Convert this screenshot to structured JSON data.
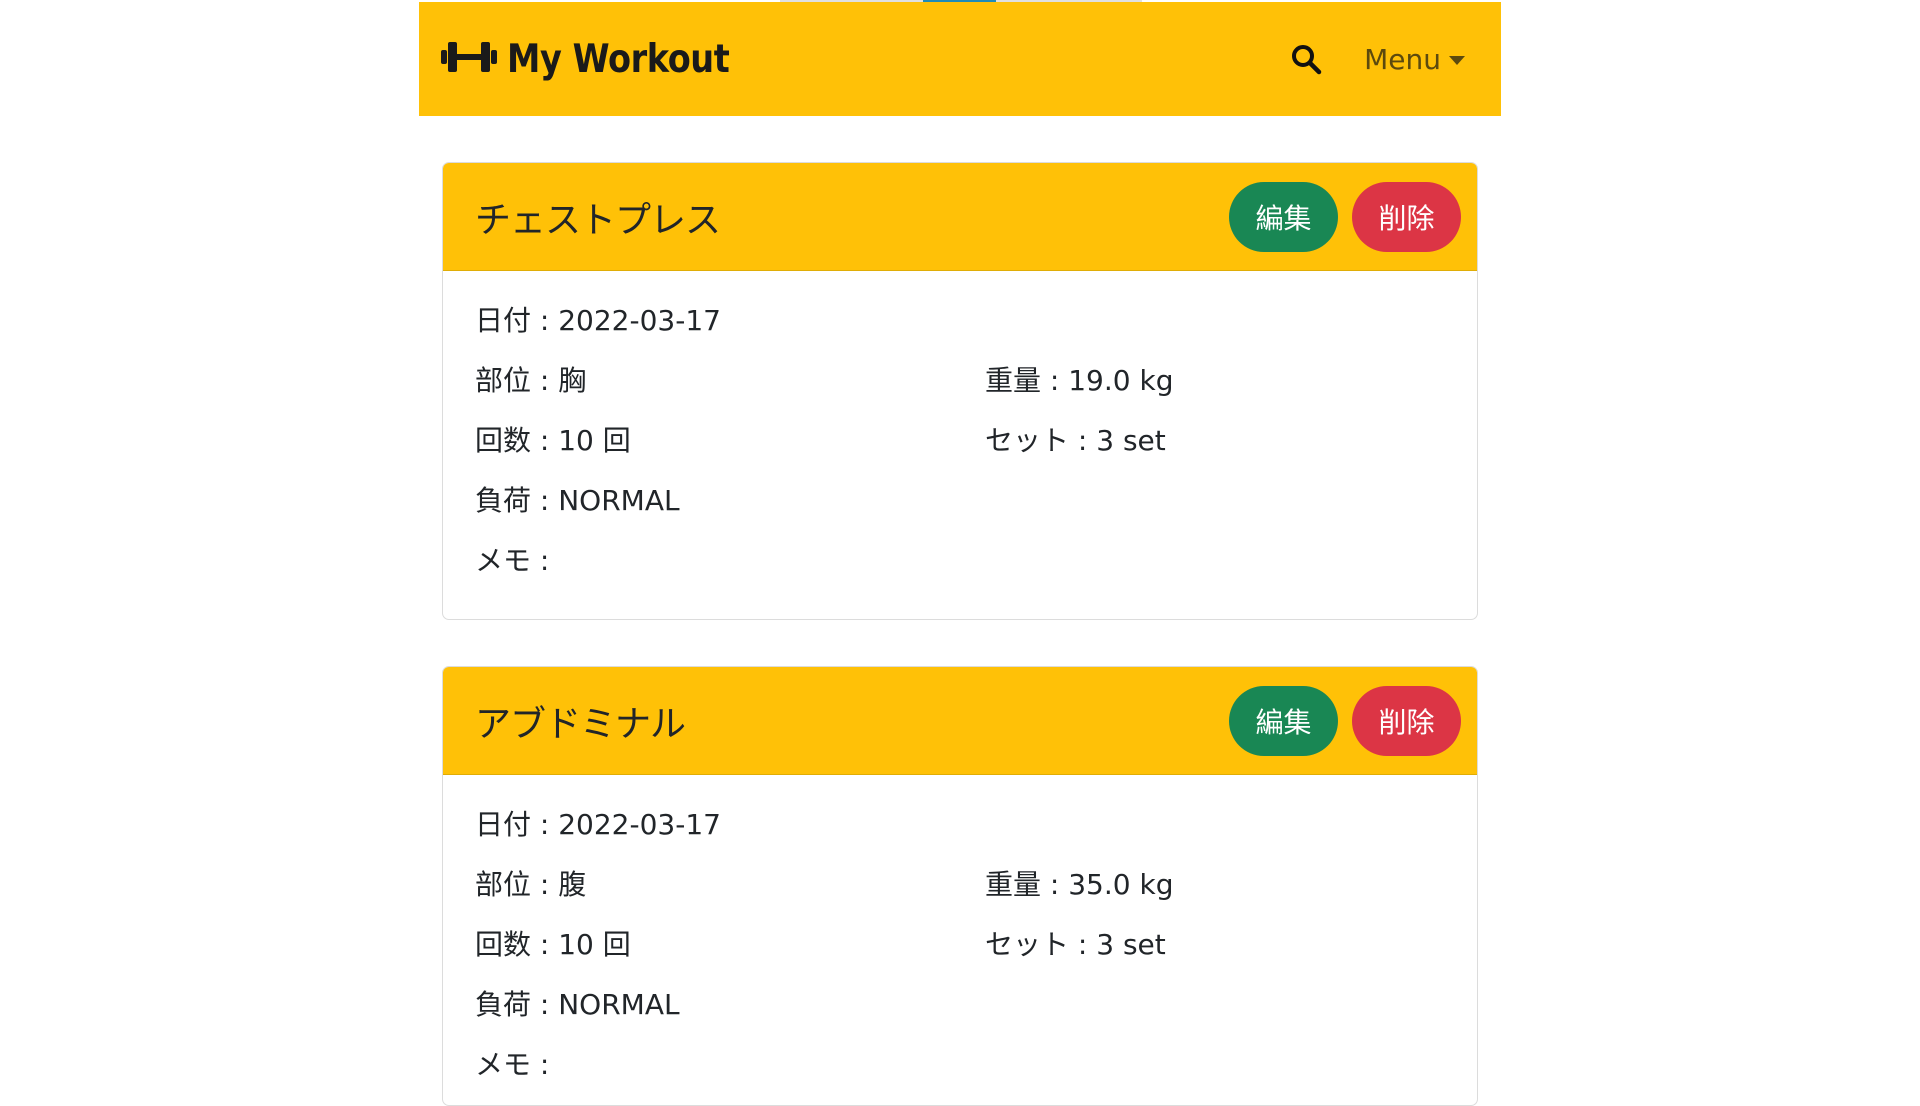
{
  "brand": {
    "icon": "dumbbell-icon",
    "title": "My Workout",
    "color": "#ffc107"
  },
  "nav": {
    "search_icon": "search-icon",
    "menu_label": "Menu",
    "menu_icon": "caret-down-icon"
  },
  "cards": [
    {
      "title": "チェストプレス",
      "edit_label": "編集",
      "delete_label": "削除",
      "date": "日付 : 2022-03-17",
      "part": "部位 : 胸",
      "weight": "重量 : 19.0 kg",
      "reps": "回数 : 10 回",
      "sets": "セット : 3 set",
      "load": "負荷 : NORMAL",
      "memo": "メモ :"
    },
    {
      "title": "アブドミナル",
      "edit_label": "編集",
      "delete_label": "削除",
      "date": "日付 : 2022-03-17",
      "part": "部位 : 腹",
      "weight": "重量 : 35.0 kg",
      "reps": "回数 : 10 回",
      "sets": "セット : 3 set",
      "load": "負荷 : NORMAL",
      "memo": "メモ :"
    }
  ],
  "colors": {
    "edit": "#198754",
    "delete": "#dc3545"
  }
}
